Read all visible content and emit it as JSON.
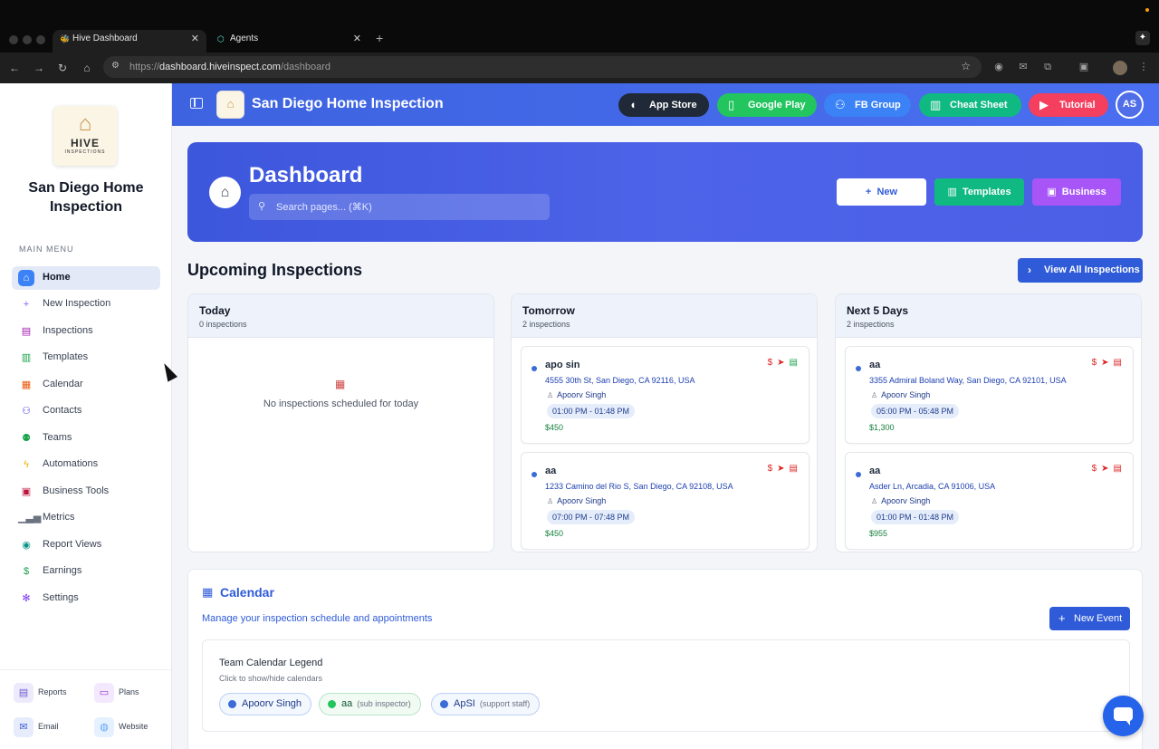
{
  "browser": {
    "tabs": [
      {
        "title": "Hive Dashboard",
        "active": true
      },
      {
        "title": "Agents",
        "active": false
      }
    ],
    "url_prefix": "https://",
    "url_host": "dashboard.hiveinspect.com",
    "url_path": "/dashboard"
  },
  "sidebar": {
    "logo_text": "HIVE",
    "logo_sub": "INSPECTIONS",
    "business_name": "San Diego Home Inspection",
    "menu_title": "MAIN MENU",
    "items": [
      {
        "label": "Home",
        "icon": "home-icon",
        "color": "#3b82f6",
        "active": true
      },
      {
        "label": "New Inspection",
        "icon": "plus-icon",
        "color": "#8b5cf6"
      },
      {
        "label": "Inspections",
        "icon": "clipboard-icon",
        "color": "#a21caf"
      },
      {
        "label": "Templates",
        "icon": "document-icon",
        "color": "#16a34a"
      },
      {
        "label": "Calendar",
        "icon": "calendar-icon",
        "color": "#ea580c"
      },
      {
        "label": "Contacts",
        "icon": "users-icon",
        "color": "#4f46e5"
      },
      {
        "label": "Teams",
        "icon": "team-icon",
        "color": "#16a34a"
      },
      {
        "label": "Automations",
        "icon": "lightning-icon",
        "color": "#eab308"
      },
      {
        "label": "Business Tools",
        "icon": "briefcase-icon",
        "color": "#be123c"
      },
      {
        "label": "Metrics",
        "icon": "bar-chart-icon",
        "color": "#6b7280"
      },
      {
        "label": "Report Views",
        "icon": "eye-icon",
        "color": "#0d9488"
      },
      {
        "label": "Earnings",
        "icon": "dollar-icon",
        "color": "#16a34a"
      },
      {
        "label": "Settings",
        "icon": "gear-icon",
        "color": "#7c3aed"
      }
    ],
    "footer": [
      {
        "label": "Reports",
        "icon": "report-icon",
        "color": "#6d5bd0"
      },
      {
        "label": "Plans",
        "icon": "card-icon",
        "color": "#9d3fd6"
      },
      {
        "label": "Email",
        "icon": "mail-icon",
        "color": "#3b5bd6"
      },
      {
        "label": "Website",
        "icon": "globe-icon",
        "color": "#60a5fa"
      }
    ]
  },
  "header": {
    "title": "San Diego Home Inspection",
    "buttons": [
      {
        "label": "App Store",
        "icon": "apple-icon",
        "color": "#1f2937"
      },
      {
        "label": "Google Play",
        "icon": "phone-icon",
        "color": "#22c55e"
      },
      {
        "label": "FB Group",
        "icon": "group-icon",
        "color": "#3b82f6"
      },
      {
        "label": "Cheat Sheet",
        "icon": "book-icon",
        "color": "#10b981"
      },
      {
        "label": "Tutorial",
        "icon": "youtube-icon",
        "color": "#f43f5e"
      }
    ],
    "avatar_initials": "AS"
  },
  "hero": {
    "title": "Dashboard",
    "search_placeholder": "Search pages... (⌘K)",
    "new_label": "New",
    "templates_label": "Templates",
    "business_label": "Business"
  },
  "upcoming": {
    "title": "Upcoming Inspections",
    "view_all_label": "View All Inspections",
    "columns": [
      {
        "title": "Today",
        "count": "0 inspections",
        "empty_text": "No inspections scheduled for today",
        "cards": []
      },
      {
        "title": "Tomorrow",
        "count": "2 inspections",
        "cards": [
          {
            "name": "apo sin",
            "address": "4555 30th St, San Diego, CA 92116, USA",
            "inspector": "Apoorv Singh",
            "time": "01:00 PM - 01:48 PM",
            "price": "$450"
          },
          {
            "name": "aa",
            "address": "1233 Camino del Rio S, San Diego, CA 92108, USA",
            "inspector": "Apoorv Singh",
            "time": "07:00 PM - 07:48 PM",
            "price": "$450"
          }
        ]
      },
      {
        "title": "Next 5 Days",
        "count": "2 inspections",
        "cards": [
          {
            "name": "aa",
            "address": "3355 Admiral Boland Way, San Diego, CA 92101, USA",
            "inspector": "Apoorv Singh",
            "time": "05:00 PM - 05:48 PM",
            "price": "$1,300"
          },
          {
            "name": "aa",
            "address": "Asder Ln, Arcadia, CA 91006, USA",
            "inspector": "Apoorv Singh",
            "time": "01:00 PM - 01:48 PM",
            "price": "$955"
          }
        ]
      }
    ]
  },
  "calendar": {
    "title": "Calendar",
    "subtitle": "Manage your inspection schedule and appointments",
    "new_event_label": "New Event",
    "legend_title": "Team Calendar Legend",
    "legend_sub": "Click to show/hide calendars",
    "chips": [
      {
        "name": "Apoorv Singh",
        "role": "",
        "color": "#3b6bd6"
      },
      {
        "name": "aa",
        "role": "(sub inspector)",
        "color": "#22c55e"
      },
      {
        "name": "ApSI",
        "role": "(support staff)",
        "color": "#3b6bd6"
      }
    ]
  }
}
